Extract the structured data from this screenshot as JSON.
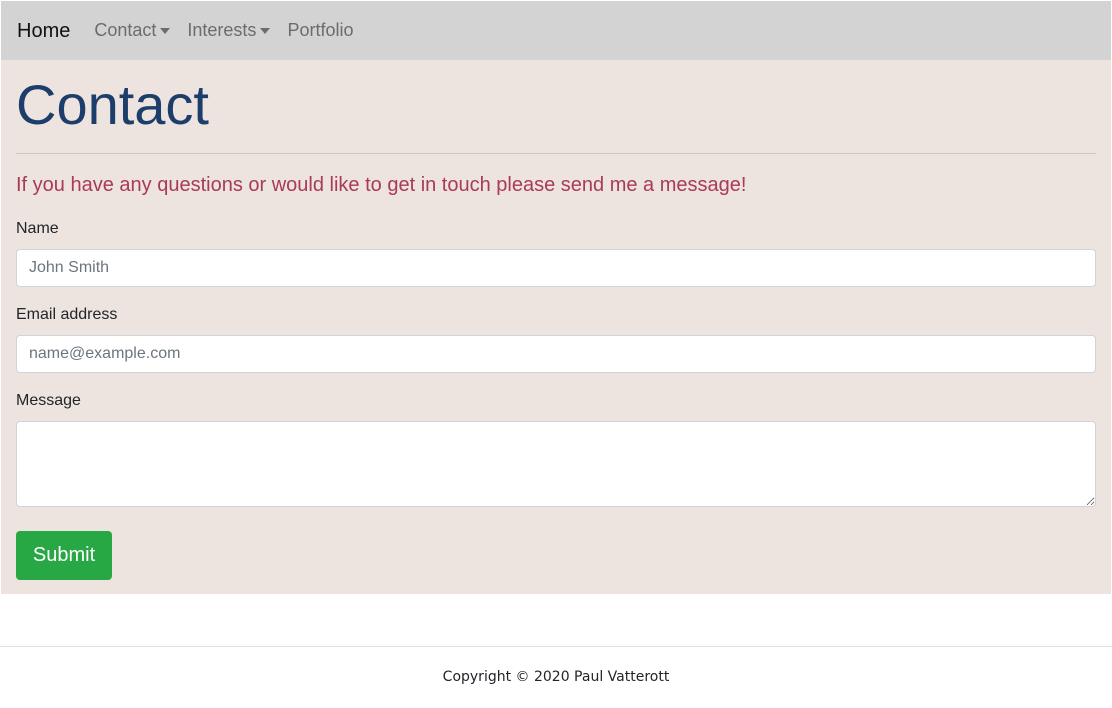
{
  "nav": {
    "brand": "Home",
    "items": [
      {
        "label": "Contact",
        "dropdown": true
      },
      {
        "label": "Interests",
        "dropdown": true
      },
      {
        "label": "Portfolio",
        "dropdown": false
      }
    ]
  },
  "main": {
    "title": "Contact",
    "lead": "If you have any questions or would like to get in touch please send me a message!",
    "form": {
      "name_label": "Name",
      "name_placeholder": "John Smith",
      "email_label": "Email address",
      "email_placeholder": "name@example.com",
      "message_label": "Message",
      "submit_label": "Submit"
    }
  },
  "footer": {
    "copyright": "Copyright © 2020 Paul Vatterott"
  },
  "colors": {
    "navbar_bg": "#d3d3d3",
    "main_bg": "#ede3df",
    "title": "#1d3e6b",
    "lead": "#a93b52",
    "submit_bg": "#28a745"
  }
}
